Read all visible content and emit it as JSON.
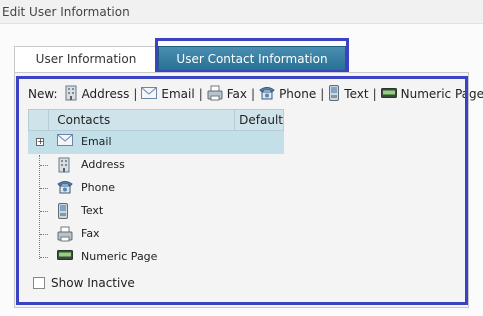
{
  "window": {
    "title": "Edit User Information"
  },
  "tabs": [
    {
      "label": "User Information",
      "active": false
    },
    {
      "label": "User Contact Information",
      "active": true
    }
  ],
  "newbar": {
    "label": "New:",
    "items": [
      {
        "label": "Address",
        "icon": "address-icon"
      },
      {
        "label": "Email",
        "icon": "email-icon"
      },
      {
        "label": "Fax",
        "icon": "fax-icon"
      },
      {
        "label": "Phone",
        "icon": "phone-icon"
      },
      {
        "label": "Text",
        "icon": "text-icon"
      },
      {
        "label": "Numeric Pager",
        "icon": "pager-icon"
      }
    ],
    "separator": "|"
  },
  "grid": {
    "columns": [
      "Contacts",
      "Default"
    ],
    "rows": [
      {
        "label": "Email",
        "icon": "email-icon",
        "selected": true,
        "expandable": true,
        "expander": "+"
      },
      {
        "label": "Address",
        "icon": "address-icon"
      },
      {
        "label": "Phone",
        "icon": "phone-icon"
      },
      {
        "label": "Text",
        "icon": "text-icon"
      },
      {
        "label": "Fax",
        "icon": "fax-icon"
      },
      {
        "label": "Numeric Page",
        "icon": "pager-icon"
      }
    ]
  },
  "show_inactive": {
    "label": "Show Inactive",
    "checked": false
  },
  "colors": {
    "accent_tab": "#2f789c",
    "highlight_border": "#3b43c4",
    "selected_row": "#c3e0e8",
    "grid_header": "#cfe3ea"
  }
}
